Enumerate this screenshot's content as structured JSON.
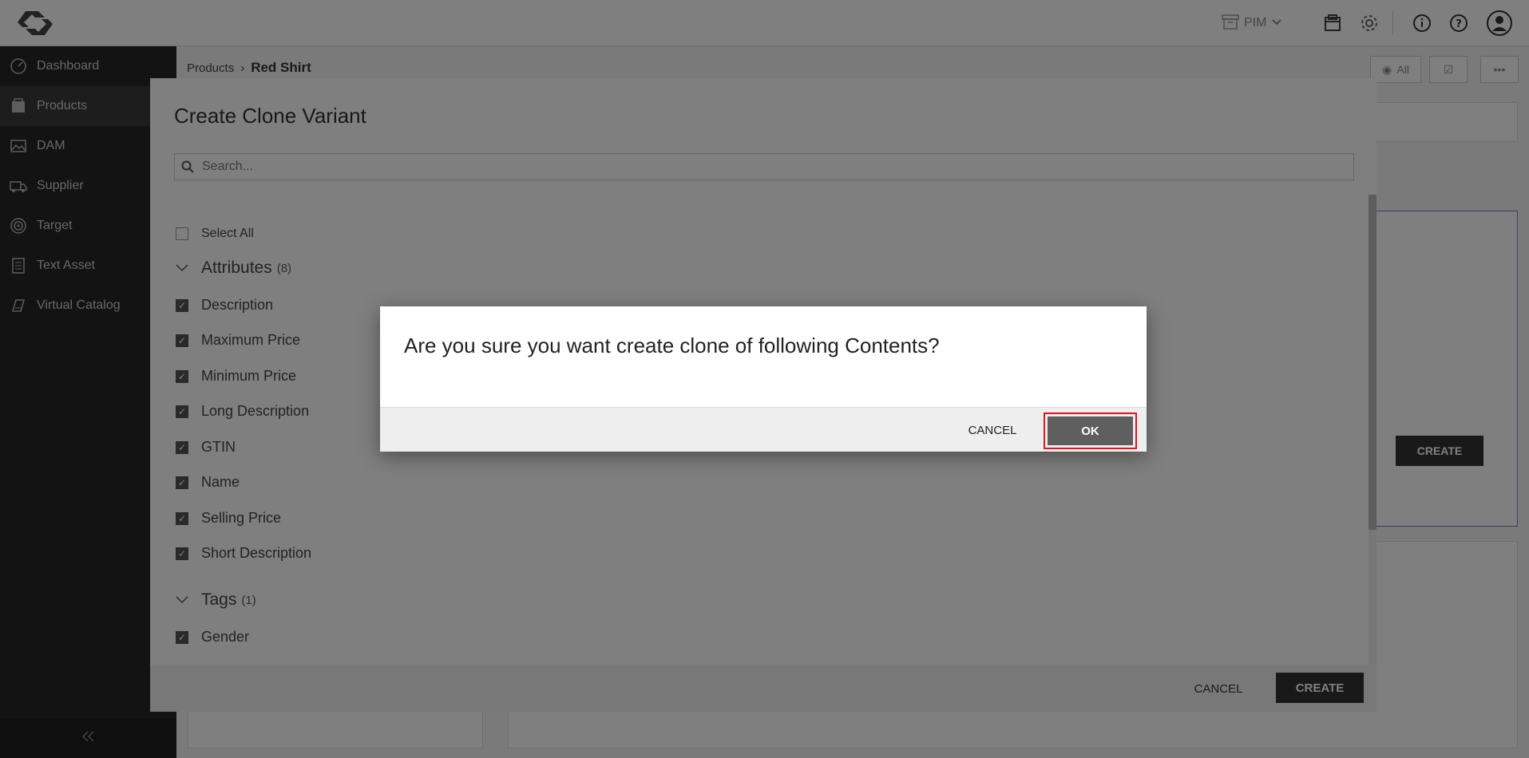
{
  "topbar": {
    "pim_label": "PIM"
  },
  "sidebar": {
    "items": [
      {
        "label": "Dashboard",
        "icon": "dashboard-icon"
      },
      {
        "label": "Products",
        "icon": "products-icon"
      },
      {
        "label": "DAM",
        "icon": "image-icon"
      },
      {
        "label": "Supplier",
        "icon": "truck-icon"
      },
      {
        "label": "Target",
        "icon": "target-icon"
      },
      {
        "label": "Text Asset",
        "icon": "document-icon"
      },
      {
        "label": "Virtual Catalog",
        "icon": "catalog-icon"
      }
    ],
    "active": "Products"
  },
  "breadcrumb": {
    "parent": "Products",
    "separator": "›",
    "current": "Red Shirt"
  },
  "background": {
    "view_label": "All",
    "create_label": "CREATE"
  },
  "clone_modal": {
    "title": "Create Clone Variant",
    "search_placeholder": "Search...",
    "select_all_label": "Select All",
    "groups": [
      {
        "label": "Attributes",
        "count": "(8)",
        "items": [
          "Description",
          "Maximum Price",
          "Minimum Price",
          "Long Description",
          "GTIN",
          "Name",
          "Selling Price",
          "Short Description"
        ]
      },
      {
        "label": "Tags",
        "count": "(1)",
        "items": [
          "Gender"
        ]
      }
    ],
    "cancel_label": "CANCEL",
    "create_label": "CREATE"
  },
  "confirm_dialog": {
    "message": "Are you sure you want create clone of following Contents?",
    "cancel_label": "CANCEL",
    "ok_label": "OK"
  },
  "colors": {
    "accent_highlight": "#e0141e",
    "sidebar_bg": "#262626",
    "button_dark": "#333333"
  }
}
